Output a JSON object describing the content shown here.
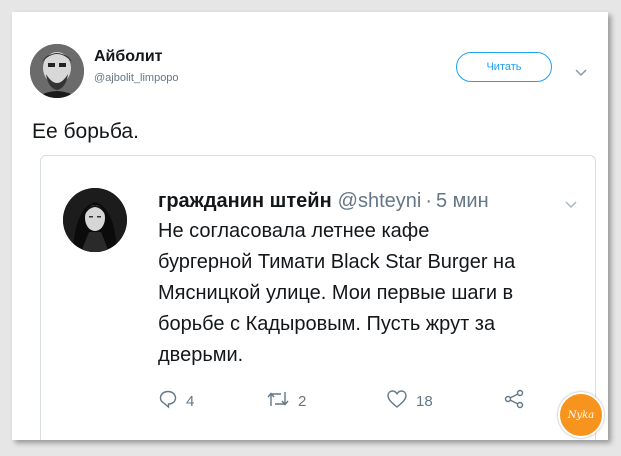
{
  "tweet": {
    "author_name": "Айболит",
    "author_handle": "@ajbolit_limpopo",
    "follow_label": "Читать",
    "text": "Ее борьба."
  },
  "quote": {
    "name": "гражданин штейн",
    "handle": "@shteyni",
    "separator": "·",
    "time": "5 мин",
    "lines": [
      "Не согласовала летнее кафе",
      "бургерной Тимати Black Star Burger на",
      "Мясницкой улице. Мои первые шаги в",
      "борьбе с Кадыровым. Пусть жрут за",
      "дверьми."
    ],
    "actions": {
      "replies": "4",
      "retweets": "2",
      "likes": "18"
    }
  },
  "watermark": "Nyka",
  "colors": {
    "accent": "#1da1f2",
    "muted": "#657786",
    "logo": "#f7941d"
  },
  "icons": [
    "reply-icon",
    "retweet-icon",
    "like-icon",
    "share-icon",
    "chevron-down-icon"
  ]
}
